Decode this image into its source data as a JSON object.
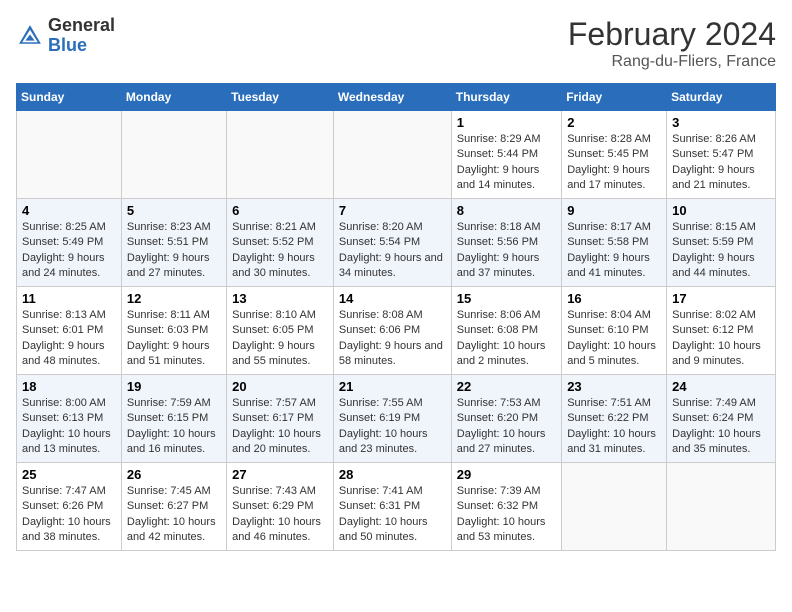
{
  "header": {
    "logo_general": "General",
    "logo_blue": "Blue",
    "title": "February 2024",
    "subtitle": "Rang-du-Fliers, France"
  },
  "weekdays": [
    "Sunday",
    "Monday",
    "Tuesday",
    "Wednesday",
    "Thursday",
    "Friday",
    "Saturday"
  ],
  "weeks": [
    [
      {
        "day": "",
        "info": ""
      },
      {
        "day": "",
        "info": ""
      },
      {
        "day": "",
        "info": ""
      },
      {
        "day": "",
        "info": ""
      },
      {
        "day": "1",
        "info": "Sunrise: 8:29 AM\nSunset: 5:44 PM\nDaylight: 9 hours and 14 minutes."
      },
      {
        "day": "2",
        "info": "Sunrise: 8:28 AM\nSunset: 5:45 PM\nDaylight: 9 hours and 17 minutes."
      },
      {
        "day": "3",
        "info": "Sunrise: 8:26 AM\nSunset: 5:47 PM\nDaylight: 9 hours and 21 minutes."
      }
    ],
    [
      {
        "day": "4",
        "info": "Sunrise: 8:25 AM\nSunset: 5:49 PM\nDaylight: 9 hours and 24 minutes."
      },
      {
        "day": "5",
        "info": "Sunrise: 8:23 AM\nSunset: 5:51 PM\nDaylight: 9 hours and 27 minutes."
      },
      {
        "day": "6",
        "info": "Sunrise: 8:21 AM\nSunset: 5:52 PM\nDaylight: 9 hours and 30 minutes."
      },
      {
        "day": "7",
        "info": "Sunrise: 8:20 AM\nSunset: 5:54 PM\nDaylight: 9 hours and 34 minutes."
      },
      {
        "day": "8",
        "info": "Sunrise: 8:18 AM\nSunset: 5:56 PM\nDaylight: 9 hours and 37 minutes."
      },
      {
        "day": "9",
        "info": "Sunrise: 8:17 AM\nSunset: 5:58 PM\nDaylight: 9 hours and 41 minutes."
      },
      {
        "day": "10",
        "info": "Sunrise: 8:15 AM\nSunset: 5:59 PM\nDaylight: 9 hours and 44 minutes."
      }
    ],
    [
      {
        "day": "11",
        "info": "Sunrise: 8:13 AM\nSunset: 6:01 PM\nDaylight: 9 hours and 48 minutes."
      },
      {
        "day": "12",
        "info": "Sunrise: 8:11 AM\nSunset: 6:03 PM\nDaylight: 9 hours and 51 minutes."
      },
      {
        "day": "13",
        "info": "Sunrise: 8:10 AM\nSunset: 6:05 PM\nDaylight: 9 hours and 55 minutes."
      },
      {
        "day": "14",
        "info": "Sunrise: 8:08 AM\nSunset: 6:06 PM\nDaylight: 9 hours and 58 minutes."
      },
      {
        "day": "15",
        "info": "Sunrise: 8:06 AM\nSunset: 6:08 PM\nDaylight: 10 hours and 2 minutes."
      },
      {
        "day": "16",
        "info": "Sunrise: 8:04 AM\nSunset: 6:10 PM\nDaylight: 10 hours and 5 minutes."
      },
      {
        "day": "17",
        "info": "Sunrise: 8:02 AM\nSunset: 6:12 PM\nDaylight: 10 hours and 9 minutes."
      }
    ],
    [
      {
        "day": "18",
        "info": "Sunrise: 8:00 AM\nSunset: 6:13 PM\nDaylight: 10 hours and 13 minutes."
      },
      {
        "day": "19",
        "info": "Sunrise: 7:59 AM\nSunset: 6:15 PM\nDaylight: 10 hours and 16 minutes."
      },
      {
        "day": "20",
        "info": "Sunrise: 7:57 AM\nSunset: 6:17 PM\nDaylight: 10 hours and 20 minutes."
      },
      {
        "day": "21",
        "info": "Sunrise: 7:55 AM\nSunset: 6:19 PM\nDaylight: 10 hours and 23 minutes."
      },
      {
        "day": "22",
        "info": "Sunrise: 7:53 AM\nSunset: 6:20 PM\nDaylight: 10 hours and 27 minutes."
      },
      {
        "day": "23",
        "info": "Sunrise: 7:51 AM\nSunset: 6:22 PM\nDaylight: 10 hours and 31 minutes."
      },
      {
        "day": "24",
        "info": "Sunrise: 7:49 AM\nSunset: 6:24 PM\nDaylight: 10 hours and 35 minutes."
      }
    ],
    [
      {
        "day": "25",
        "info": "Sunrise: 7:47 AM\nSunset: 6:26 PM\nDaylight: 10 hours and 38 minutes."
      },
      {
        "day": "26",
        "info": "Sunrise: 7:45 AM\nSunset: 6:27 PM\nDaylight: 10 hours and 42 minutes."
      },
      {
        "day": "27",
        "info": "Sunrise: 7:43 AM\nSunset: 6:29 PM\nDaylight: 10 hours and 46 minutes."
      },
      {
        "day": "28",
        "info": "Sunrise: 7:41 AM\nSunset: 6:31 PM\nDaylight: 10 hours and 50 minutes."
      },
      {
        "day": "29",
        "info": "Sunrise: 7:39 AM\nSunset: 6:32 PM\nDaylight: 10 hours and 53 minutes."
      },
      {
        "day": "",
        "info": ""
      },
      {
        "day": "",
        "info": ""
      }
    ]
  ]
}
